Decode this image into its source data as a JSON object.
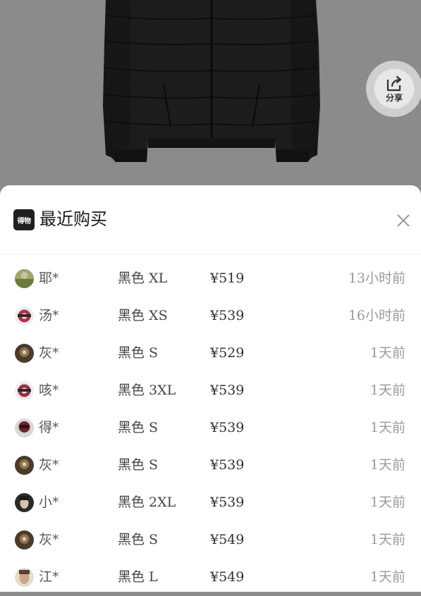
{
  "header": {
    "brand_logo": "得物",
    "title": "最近购买"
  },
  "share": {
    "label": "分享"
  },
  "purchases": [
    {
      "name": "耶*",
      "variant": "黑色 XL",
      "price": "¥519",
      "time": "13小时前",
      "avatar_color": "#6b7a3e"
    },
    {
      "name": "汤*",
      "variant": "黑色 XS",
      "price": "¥539",
      "time": "16小时前",
      "avatar_color": "#b0334a"
    },
    {
      "name": "灰*",
      "variant": "黑色 S",
      "price": "¥529",
      "time": "1天前",
      "avatar_color": "#4a3a2a"
    },
    {
      "name": "咳*",
      "variant": "黑色 3XL",
      "price": "¥539",
      "time": "1天前",
      "avatar_color": "#a03040"
    },
    {
      "name": "得*",
      "variant": "黑色 S",
      "price": "¥539",
      "time": "1天前",
      "avatar_color": "#7a1e24"
    },
    {
      "name": "灰*",
      "variant": "黑色 S",
      "price": "¥539",
      "time": "1天前",
      "avatar_color": "#4a3a2a"
    },
    {
      "name": "小*",
      "variant": "黑色 2XL",
      "price": "¥539",
      "time": "1天前",
      "avatar_color": "#2b2b2b"
    },
    {
      "name": "灰*",
      "variant": "黑色 S",
      "price": "¥549",
      "time": "1天前",
      "avatar_color": "#4a3a2a"
    },
    {
      "name": "江*",
      "variant": "黑色 L",
      "price": "¥549",
      "time": "1天前",
      "avatar_color": "#c9a58a"
    }
  ],
  "colors": {
    "sheet_background": "#ffffff",
    "image_background": "#8b8b8b",
    "jacket": "#1b1b1b",
    "time_text": "#9a9a9a"
  },
  "icons": {
    "share": "share-icon",
    "close": "close-icon"
  }
}
